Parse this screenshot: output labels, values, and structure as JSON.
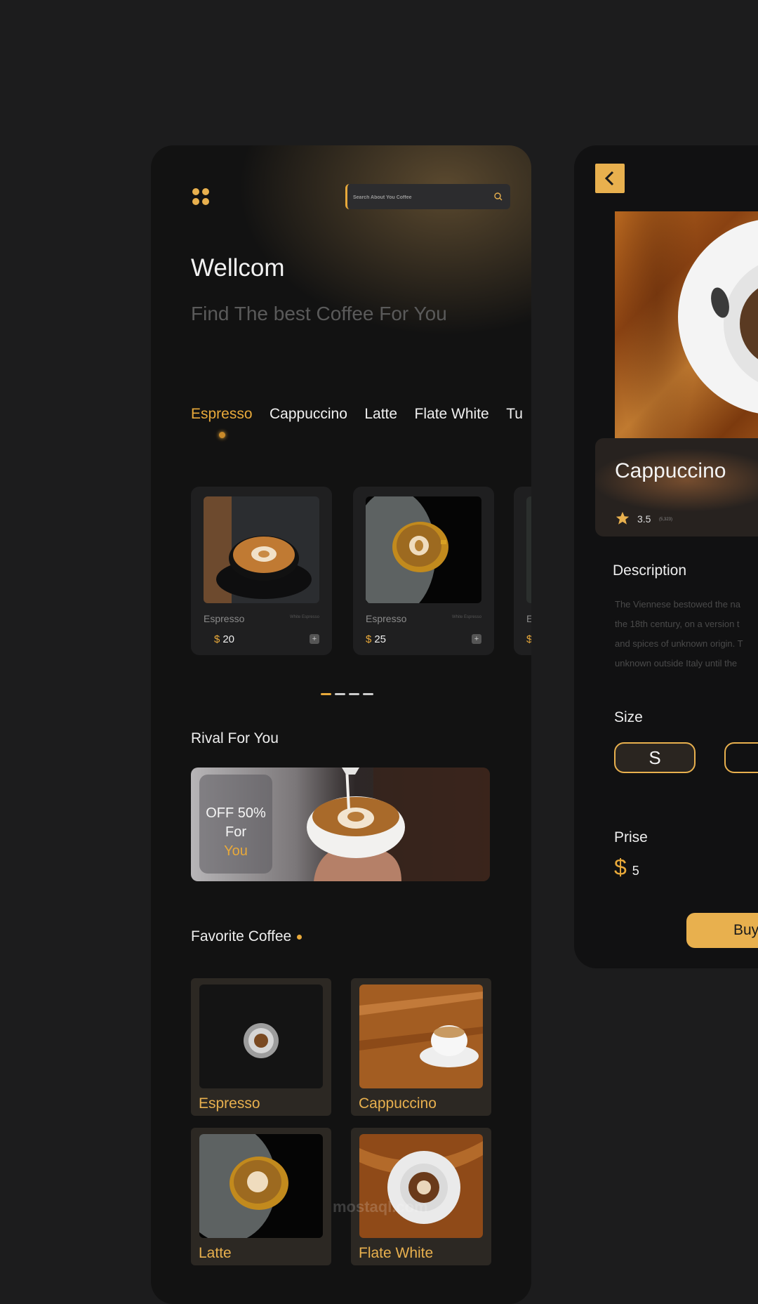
{
  "colors": {
    "background": "#1c1c1d",
    "accent": "#e8b04e",
    "panel": "#121212"
  },
  "home": {
    "search_placeholder": "Search About You Coffee",
    "welcome": "Wellcom",
    "subtitle": "Find The best Coffee For You",
    "tabs": [
      "Espresso",
      "Cappuccino",
      "Latte",
      "Flate White",
      "Tu"
    ],
    "active_tab": "Espresso",
    "cards": [
      {
        "name": "Espresso",
        "sub": "White Espresso",
        "currency": "$",
        "price": "20"
      },
      {
        "name": "Espresso",
        "sub": "White Espresso",
        "currency": "$",
        "price": "25"
      },
      {
        "name": "E",
        "sub": "",
        "currency": "$",
        "price": ""
      }
    ],
    "rival_title": "Rival For You",
    "promo": {
      "line1": "OFF 50%",
      "line2": "For",
      "line3": "You"
    },
    "favorite_title": "Favorite Coffee",
    "favorites": [
      "Espresso",
      "Cappuccino",
      "Latte",
      "Flate White"
    ]
  },
  "detail": {
    "title": "Cappuccino",
    "rating": "3.5",
    "rating_count": "(5,323)",
    "description_title": "Description",
    "description_lines": [
      "The Viennese bestowed the na",
      "the 18th century, on a version t",
      "and spices of unknown origin. T",
      "unknown outside Italy until the"
    ],
    "size_title": "Size",
    "sizes": [
      "S",
      ""
    ],
    "price_title": "Prise",
    "currency": "$",
    "price": "5",
    "buy_label": "Buy"
  },
  "watermark": "mostaql.com"
}
